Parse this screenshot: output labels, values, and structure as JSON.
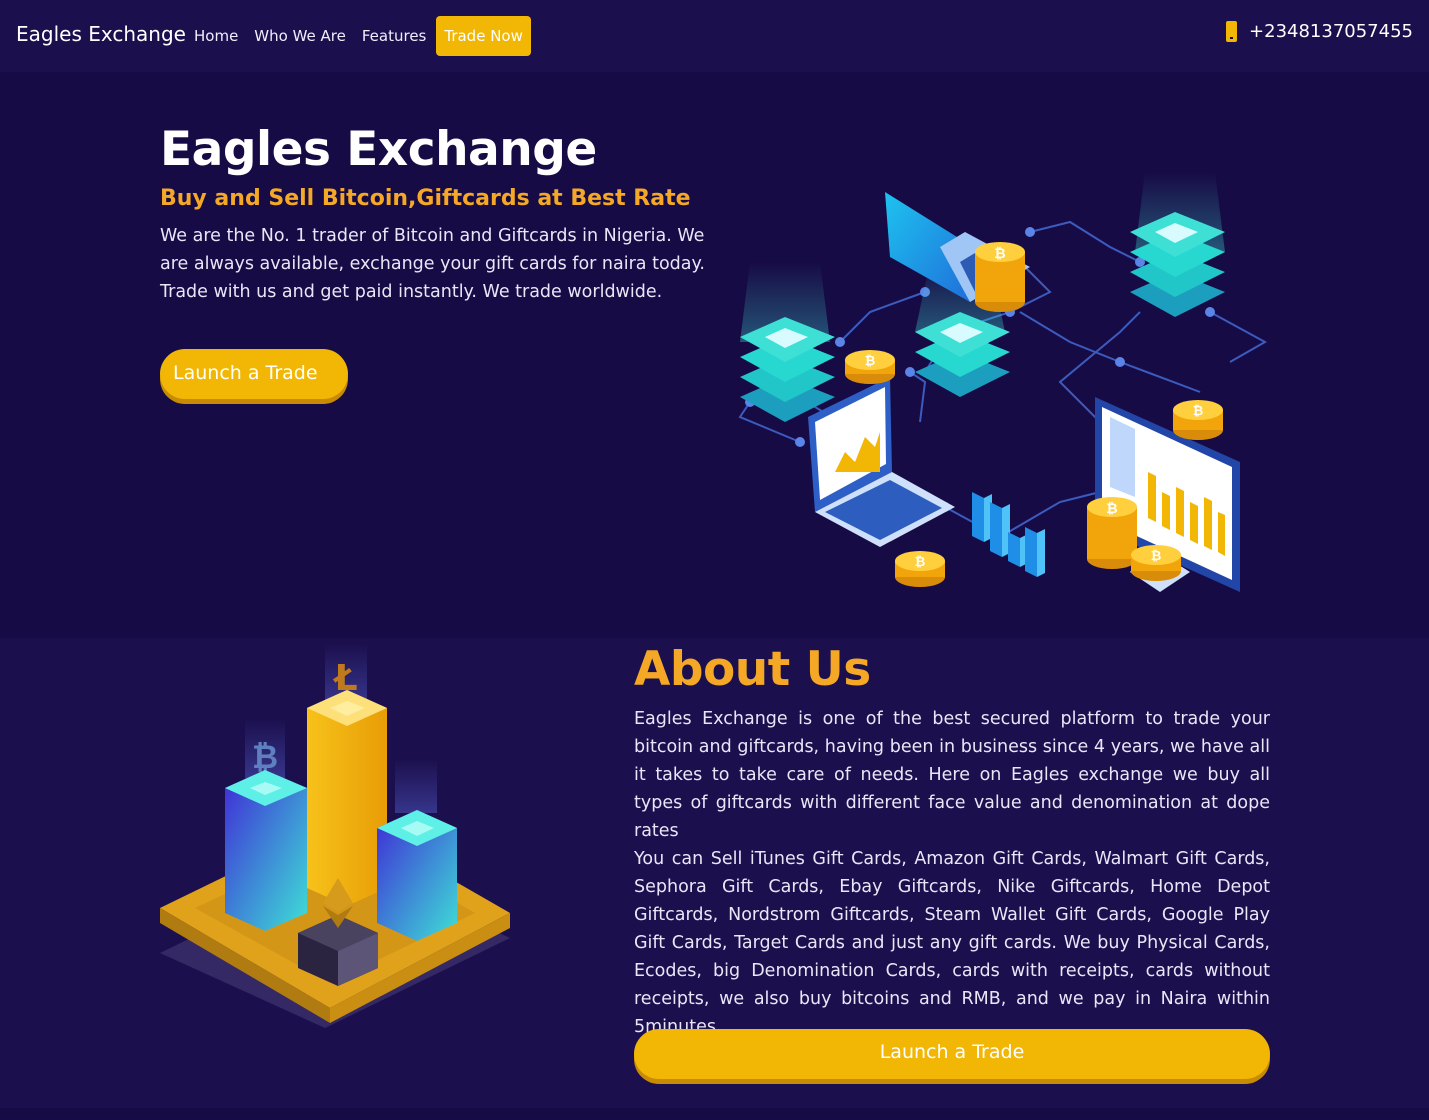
{
  "nav": {
    "brand": "Eagles Exchange",
    "links": [
      {
        "label": "Home"
      },
      {
        "label": "Who We Are"
      },
      {
        "label": "Features"
      }
    ],
    "cta_label": "Trade Now",
    "phone_icon": "phone-icon",
    "phone": "+2348137057455"
  },
  "hero": {
    "title": "Eagles Exchange",
    "subtitle": "Buy and Sell Bitcoin,Giftcards at Best Rate",
    "text": "We are the No. 1 trader of Bitcoin and Giftcards in Nigeria. We are always available, exchange your gift cards for naira today. Trade with us and get paid instantly. We trade worldwide.",
    "button_label": "Launch a Trade"
  },
  "about": {
    "title": "About Us",
    "paragraph1": "Eagles Exchange is one of the best secured platform to trade your bitcoin and giftcards, having been in business since 4 years, we have all it takes to take care of needs. Here on Eagles exchange we buy all types of giftcards with different face value and denomination at dope rates",
    "paragraph2": "You can Sell iTunes Gift Cards, Amazon Gift Cards, Walmart Gift Cards, Sephora Gift Cards, Ebay Giftcards, Nike Giftcards, Home Depot Giftcards, Nordstrom Giftcards, Steam Wallet Gift Cards, Google Play Gift Cards, Target Cards and just any gift cards. We buy Physical Cards, Ecodes, big Denomination Cards, cards with receipts, cards without receipts, we also buy bitcoins and RMB, and we pay in Naira within 5minutes.",
    "button_label": "Launch a Trade"
  },
  "colors": {
    "background": "#170b45",
    "nav_background": "#1b0f4d",
    "accent": "#f2b705",
    "heading_orange": "#f4a825",
    "cyan": "#3ee0d6"
  }
}
